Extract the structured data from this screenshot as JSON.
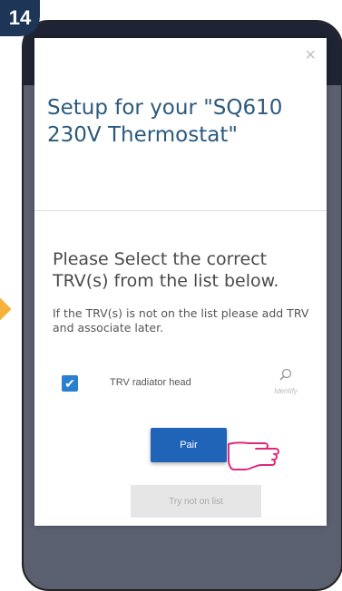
{
  "step_badge": "14",
  "dialog": {
    "close_symbol": "×",
    "title": "Setup for your \"SQ610 230V Thermostat\"",
    "prompt": "Please Select the correct TRV(s) from the list below.",
    "hint": "If the TRV(s) is not on the list please add TRV and associate later.",
    "device_label": "TRV radiator head",
    "device_checked": true,
    "identify_label": "Identify",
    "identify_icon": "magnifier-icon",
    "pair_label": "Pair",
    "try_not_label": "Try not on list"
  },
  "colors": {
    "title": "#2c5a7d",
    "accent": "#1f64b6",
    "checkbox": "#2a7fd0",
    "badge": "#1d3557",
    "arrow": "#f6b13a"
  }
}
